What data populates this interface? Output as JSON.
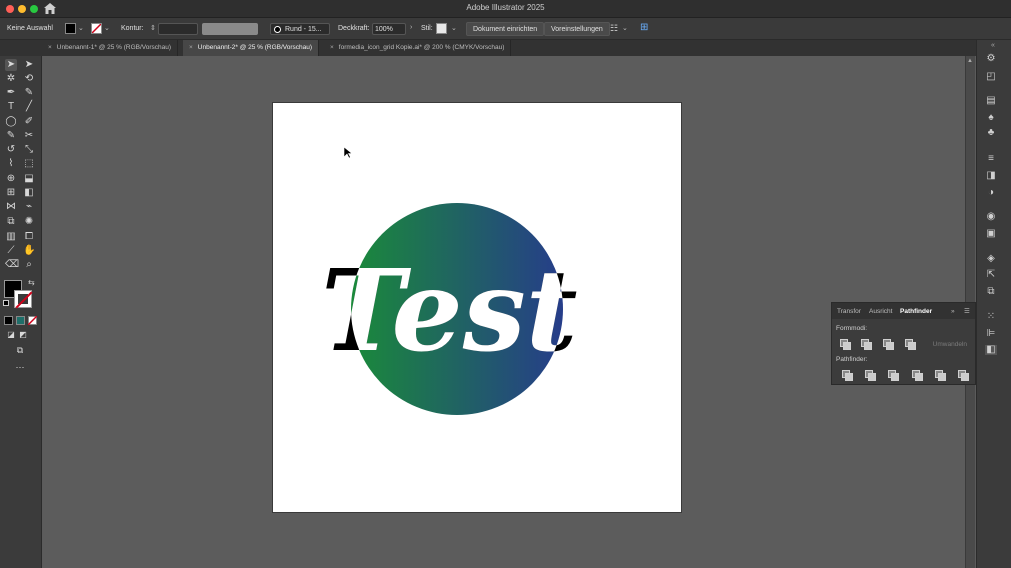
{
  "window": {
    "title": "Adobe Illustrator 2025"
  },
  "control_bar": {
    "selection": "Keine Auswahl",
    "stroke_label": "Kontur:",
    "brush_value": "Rund - 15...",
    "opacity_label": "Deckkraft:",
    "opacity_value": "100%",
    "style_label": "Stil:",
    "document_setup_button": "Dokument einrichten",
    "preferences_button": "Voreinstellungen"
  },
  "tabs": [
    {
      "label": "Unbenannt-1* @ 25 % (RGB/Vorschau)",
      "active": false
    },
    {
      "label": "Unbenannt-2* @ 25 % (RGB/Vorschau)",
      "active": true
    },
    {
      "label": "formedia_icon_grid Kopie.ai* @ 200 % (CMYK/Vorschau)",
      "active": false
    }
  ],
  "artwork": {
    "text": "Test",
    "gradient_start": "#1a8a3a",
    "gradient_end": "#263d8a",
    "text_color": "#ffffff",
    "overflow_color": "#000000"
  },
  "pathfinder_panel": {
    "tabs": [
      "Transfor",
      "Ausricht",
      "Pathfinder"
    ],
    "active_tab": "Pathfinder",
    "shape_modes_label": "Formmodi:",
    "expand_button": "Umwandeln",
    "pathfinders_label": "Pathfinder:"
  },
  "colors": {
    "traffic_red": "#ff5f57",
    "traffic_yellow": "#febc2e",
    "traffic_green": "#28c840"
  }
}
